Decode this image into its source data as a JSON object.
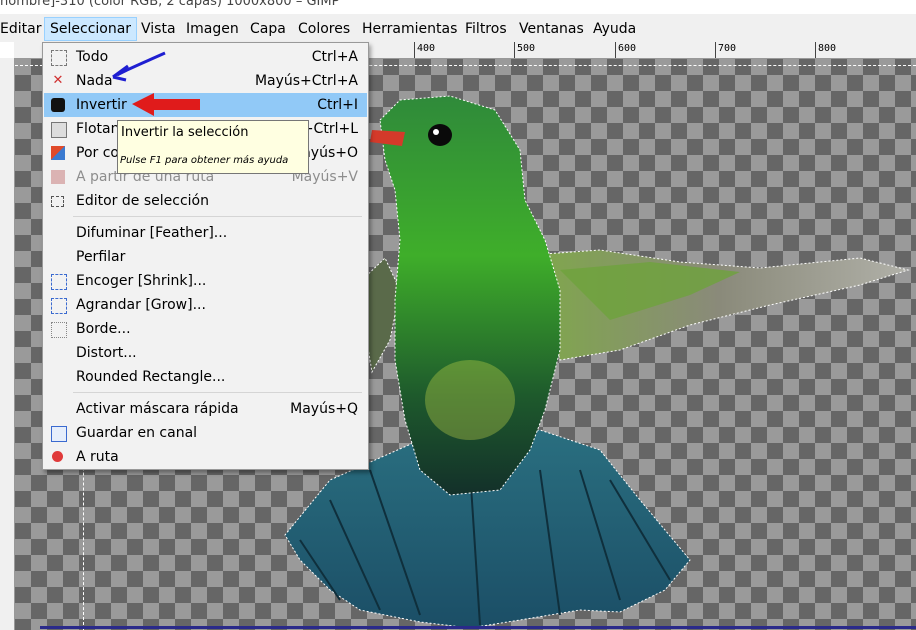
{
  "window": {
    "title_fragment": "nombre]-310 (color RGB, 2 capas) 1000x800 – GIMP"
  },
  "menubar": [
    {
      "label": "Editar"
    },
    {
      "label": "Seleccionar"
    },
    {
      "label": "Vista"
    },
    {
      "label": "Imagen"
    },
    {
      "label": "Capa"
    },
    {
      "label": "Colores"
    },
    {
      "label": "Herramientas"
    },
    {
      "label": "Filtros"
    },
    {
      "label": "Ventanas"
    },
    {
      "label": "Ayuda"
    }
  ],
  "ruler": {
    "labels": [
      "400",
      "500",
      "600",
      "700",
      "800"
    ]
  },
  "menu": {
    "items": [
      {
        "label": "Todo",
        "shortcut": "Ctrl+A",
        "icon": "select-all-icon"
      },
      {
        "label": "Nada",
        "shortcut": "Mayús+Ctrl+A",
        "icon": "select-none-icon"
      },
      {
        "label": "Invertir",
        "shortcut": "Ctrl+I",
        "icon": "invert-icon",
        "highlighted": true
      },
      {
        "label": "Flotante",
        "shortcut": "Mayús+Ctrl+L",
        "icon": "float-icon"
      },
      {
        "label": "Por color",
        "shortcut": "Mayús+O",
        "icon": "by-color-icon"
      },
      {
        "label": "A partir de una ruta",
        "shortcut": "Mayús+V",
        "icon": "from-path-icon",
        "disabled": true
      },
      {
        "label": "Editor de selección",
        "shortcut": "",
        "icon": "selection-editor-icon"
      },
      {
        "label": "Difuminar [Feather]...",
        "shortcut": ""
      },
      {
        "label": "Perfilar",
        "shortcut": ""
      },
      {
        "label": "Encoger [Shrink]...",
        "shortcut": "",
        "icon": "shrink-icon"
      },
      {
        "label": "Agrandar [Grow]...",
        "shortcut": "",
        "icon": "grow-icon"
      },
      {
        "label": "Borde...",
        "shortcut": "",
        "icon": "border-icon"
      },
      {
        "label": "Distort...",
        "shortcut": ""
      },
      {
        "label": "Rounded Rectangle...",
        "shortcut": ""
      },
      {
        "label": "Activar máscara rápida",
        "shortcut": "Mayús+Q"
      },
      {
        "label": "Guardar en canal",
        "shortcut": "",
        "icon": "save-channel-icon"
      },
      {
        "label": "A ruta",
        "shortcut": "",
        "icon": "to-path-icon"
      }
    ]
  },
  "tooltip": {
    "title": "Invertir la selección",
    "hint": "Pulse F1 para obtener más ayuda"
  },
  "colors": {
    "highlight": "#91c9f7",
    "menubar_active": "#cce8ff",
    "annotation_blue": "#1f1fd1",
    "annotation_red": "#e01b1b"
  }
}
